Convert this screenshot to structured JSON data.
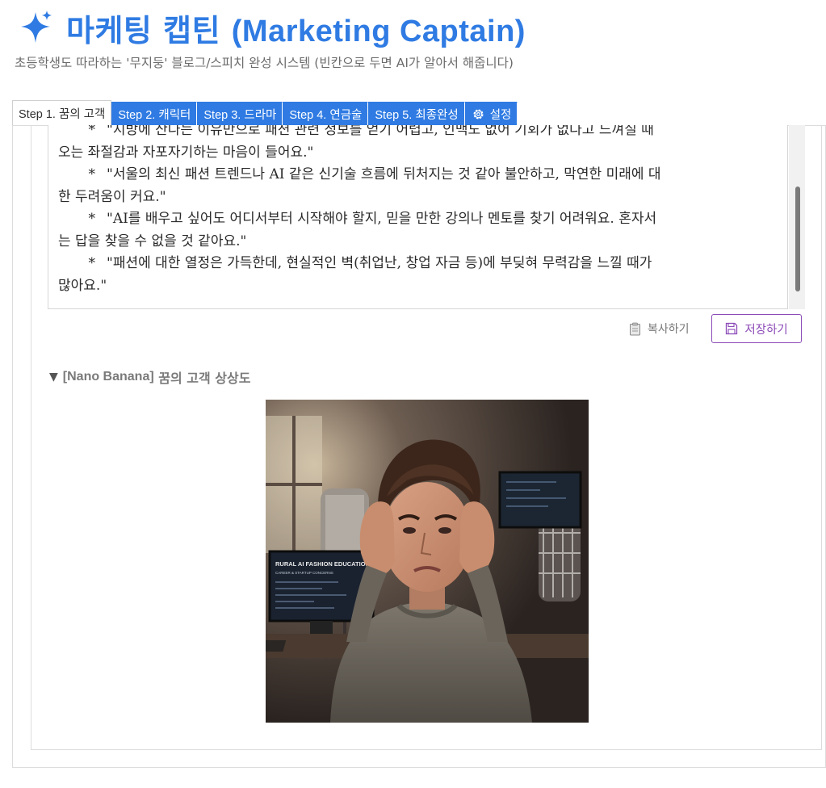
{
  "header": {
    "icon": "sparkle-icon",
    "title_ko": "마케팅 캡틴",
    "title_en": "(Marketing Captain)",
    "accent_color": "#2f7be3",
    "subtitle": "초등학생도 따라하는 '무지둥' 블로그/스피치 완성 시스템 (빈칸으로 두면 AI가 알아서 해줍니다)"
  },
  "tabs": [
    {
      "label": "Step 1. 꿈의 고객",
      "active": true
    },
    {
      "label": "Step 2. 캐릭터",
      "active": false
    },
    {
      "label": "Step 3. 드라마",
      "active": false
    },
    {
      "label": "Step 4. 연금술",
      "active": false
    },
    {
      "label": "Step 5. 최종완성",
      "active": false
    },
    {
      "label": "설정",
      "icon": "gear-icon",
      "active": false
    }
  ],
  "editor": {
    "lines": [
      {
        "bullet": "*",
        "text": "\"지방에 산다는 이유만으로 패션 관련 정보를 얻기 어렵고, 인맥도 없어 기회가 없다고 느껴질 때"
      },
      {
        "bullet": "",
        "text": "오는 좌절감과 자포자기하는 마음이 들어요.\""
      },
      {
        "bullet": "*",
        "text": "\"서울의 최신 패션 트렌드나 AI 같은 신기술 흐름에 뒤처지는 것 같아 불안하고, 막연한 미래에 대"
      },
      {
        "bullet": "",
        "text": "한 두려움이 커요.\""
      },
      {
        "bullet": "*",
        "text": "\"AI를 배우고 싶어도 어디서부터 시작해야 할지, 믿을 만한 강의나 멘토를 찾기 어려워요. 혼자서"
      },
      {
        "bullet": "",
        "text": "는 답을 찾을 수 없을 것 같아요.\""
      },
      {
        "bullet": "*",
        "text": "\"패션에 대한 열정은 가득한데, 현실적인 벽(취업난, 창업 자금 등)에 부딪혀 무력감을 느낄 때가"
      },
      {
        "bullet": "",
        "text": "많아요.\""
      }
    ]
  },
  "actions": {
    "copy_label": "복사하기",
    "copy_icon": "clipboard-icon",
    "save_label": "저장하기",
    "save_icon": "floppy-icon",
    "save_color": "#8c4bb8"
  },
  "expander": {
    "caret": "▼",
    "label_tag": "[Nano Banana]",
    "label_text": "꿈의 고객 상상도"
  },
  "image": {
    "monitor_text_1": "RURAL AI FASHION EDUCATION",
    "monitor_text_2": "CAREER & STARTUP CONCERNS"
  }
}
